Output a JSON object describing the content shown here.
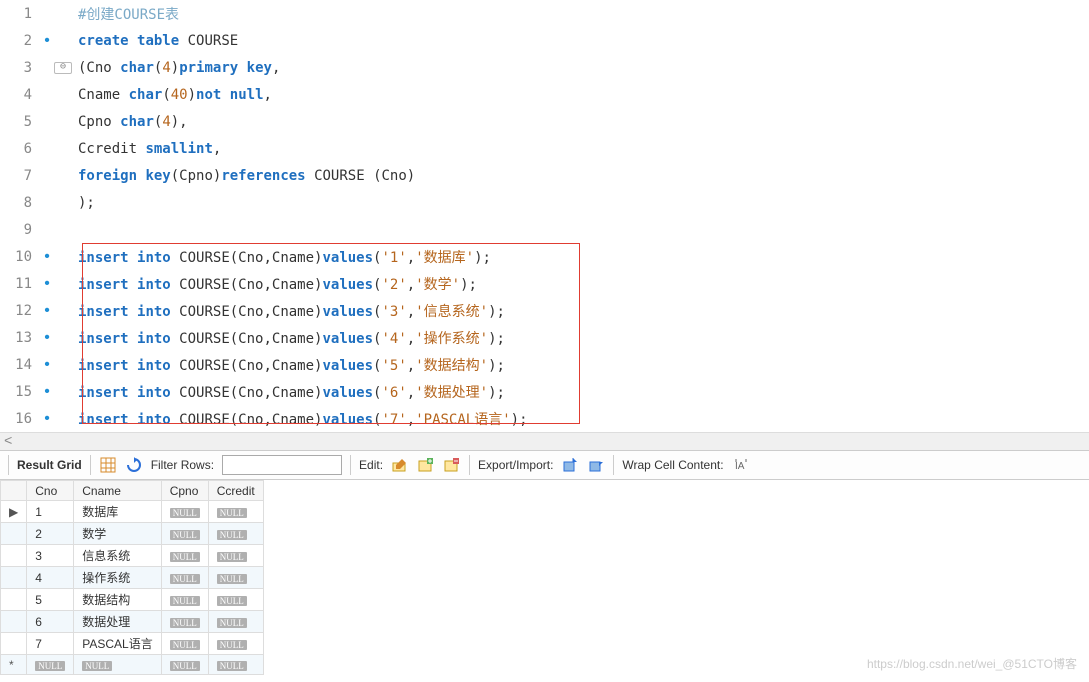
{
  "editor": {
    "lines": [
      {
        "n": "1",
        "marker": "",
        "fold": "",
        "html": "<span class='c-comment'>#创建COURSE表</span>"
      },
      {
        "n": "2",
        "marker": "•",
        "fold": "",
        "html": "<span class='c-kw'>create</span> <span class='c-kw'>table</span> <span class='c-id'>COURSE</span>"
      },
      {
        "n": "3",
        "marker": "",
        "fold": "⊖",
        "html": "<span class='c-id'>(Cno</span> <span class='c-type'>char</span><span class='c-id'>(</span><span class='c-num'>4</span><span class='c-id'>)</span><span class='c-kw'>primary</span> <span class='c-kw'>key</span><span class='c-id'>,</span>"
      },
      {
        "n": "4",
        "marker": "",
        "fold": "",
        "html": "<span class='c-id'>Cname</span> <span class='c-type'>char</span><span class='c-id'>(</span><span class='c-num'>40</span><span class='c-id'>)</span><span class='c-kw'>not</span> <span class='c-kw'>null</span><span class='c-id'>,</span>"
      },
      {
        "n": "5",
        "marker": "",
        "fold": "",
        "html": "<span class='c-id'>Cpno</span> <span class='c-type'>char</span><span class='c-id'>(</span><span class='c-num'>4</span><span class='c-id'>),</span>"
      },
      {
        "n": "6",
        "marker": "",
        "fold": "",
        "html": "<span class='c-id'>Ccredit</span> <span class='c-type'>smallint</span><span class='c-id'>,</span>"
      },
      {
        "n": "7",
        "marker": "",
        "fold": "",
        "html": "<span class='c-kw'>foreign</span> <span class='c-kw'>key</span><span class='c-id'>(Cpno)</span><span class='c-kw'>references</span> <span class='c-id'>COURSE (Cno)</span>"
      },
      {
        "n": "8",
        "marker": "",
        "fold": "",
        "html": "<span class='c-id'>);</span>"
      },
      {
        "n": "9",
        "marker": "",
        "fold": "",
        "html": " "
      },
      {
        "n": "10",
        "marker": "•",
        "fold": "",
        "html": "<span class='c-kw'>insert</span> <span class='c-kw'>into</span> <span class='c-id'>COURSE(Cno,Cname)</span><span class='c-func'>values</span><span class='c-id'>(</span><span class='c-str'>'1'</span><span class='c-id'>,</span><span class='c-str'>'数据库'</span><span class='c-id'>);</span>"
      },
      {
        "n": "11",
        "marker": "•",
        "fold": "",
        "html": "<span class='c-kw'>insert</span> <span class='c-kw'>into</span> <span class='c-id'>COURSE(Cno,Cname)</span><span class='c-func'>values</span><span class='c-id'>(</span><span class='c-str'>'2'</span><span class='c-id'>,</span><span class='c-str'>'数学'</span><span class='c-id'>);</span>"
      },
      {
        "n": "12",
        "marker": "•",
        "fold": "",
        "html": "<span class='c-kw'>insert</span> <span class='c-kw'>into</span> <span class='c-id'>COURSE(Cno,Cname)</span><span class='c-func'>values</span><span class='c-id'>(</span><span class='c-str'>'3'</span><span class='c-id'>,</span><span class='c-str'>'信息系统'</span><span class='c-id'>);</span>"
      },
      {
        "n": "13",
        "marker": "•",
        "fold": "",
        "html": "<span class='c-kw'>insert</span> <span class='c-kw'>into</span> <span class='c-id'>COURSE(Cno,Cname)</span><span class='c-func'>values</span><span class='c-id'>(</span><span class='c-str'>'4'</span><span class='c-id'>,</span><span class='c-str'>'操作系统'</span><span class='c-id'>);</span>"
      },
      {
        "n": "14",
        "marker": "•",
        "fold": "",
        "html": "<span class='c-kw'>insert</span> <span class='c-kw'>into</span> <span class='c-id'>COURSE(Cno,Cname)</span><span class='c-func'>values</span><span class='c-id'>(</span><span class='c-str'>'5'</span><span class='c-id'>,</span><span class='c-str'>'数据结构'</span><span class='c-id'>);</span>"
      },
      {
        "n": "15",
        "marker": "•",
        "fold": "",
        "html": "<span class='c-kw'>insert</span> <span class='c-kw'>into</span> <span class='c-id'>COURSE(Cno,Cname)</span><span class='c-func'>values</span><span class='c-id'>(</span><span class='c-str'>'6'</span><span class='c-id'>,</span><span class='c-str'>'数据处理'</span><span class='c-id'>);</span>"
      },
      {
        "n": "16",
        "marker": "•",
        "fold": "",
        "html": "<span class='c-kw'>insert</span> <span class='c-kw'>into</span> <span class='c-id'>COURSE(Cno,Cname)</span><span class='c-func'>values</span><span class='c-id'>(</span><span class='c-str'>'7'</span><span class='c-id'>,</span><span class='c-str'>'PASCAL语言'</span><span class='c-id'>);</span>"
      }
    ]
  },
  "toolbar": {
    "result_grid": "Result Grid",
    "filter_rows": "Filter Rows:",
    "filter_value": "",
    "edit": "Edit:",
    "export_import": "Export/Import:",
    "wrap_cell": "Wrap Cell Content:"
  },
  "grid": {
    "columns": [
      "Cno",
      "Cname",
      "Cpno",
      "Ccredit"
    ],
    "rows": [
      {
        "marker": "▶",
        "cells": [
          "1",
          "数据库",
          "NULL",
          "NULL"
        ]
      },
      {
        "marker": "",
        "cells": [
          "2",
          "数学",
          "NULL",
          "NULL"
        ]
      },
      {
        "marker": "",
        "cells": [
          "3",
          "信息系统",
          "NULL",
          "NULL"
        ]
      },
      {
        "marker": "",
        "cells": [
          "4",
          "操作系统",
          "NULL",
          "NULL"
        ]
      },
      {
        "marker": "",
        "cells": [
          "5",
          "数据结构",
          "NULL",
          "NULL"
        ]
      },
      {
        "marker": "",
        "cells": [
          "6",
          "数据处理",
          "NULL",
          "NULL"
        ]
      },
      {
        "marker": "",
        "cells": [
          "7",
          "PASCAL语言",
          "NULL",
          "NULL"
        ]
      },
      {
        "marker": "*",
        "cells": [
          "NULL",
          "NULL",
          "NULL",
          "NULL"
        ]
      }
    ]
  },
  "watermark": "https://blog.csdn.net/wei_@51CTO博客"
}
